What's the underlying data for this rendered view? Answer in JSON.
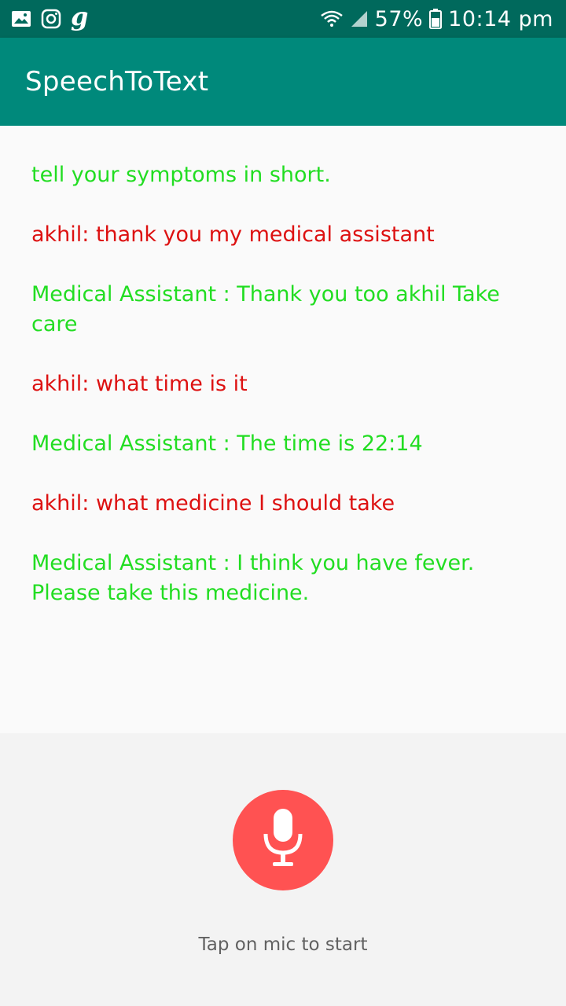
{
  "status_bar": {
    "battery_percent": "57%",
    "time": "10:14 pm",
    "left_icons": [
      "gallery-icon",
      "instagram-icon",
      "g-app-icon"
    ],
    "g_glyph": "g"
  },
  "app_bar": {
    "title": "SpeechToText"
  },
  "messages": [
    {
      "text": "tell your symptoms in short.",
      "color": "#22dd22"
    },
    {
      "text": "akhil: thank you my medical assistant",
      "color": "#dd1111"
    },
    {
      "text": "Medical Assistant : Thank you too akhil Take care",
      "color": "#22dd22"
    },
    {
      "text": "akhil: what time is it",
      "color": "#dd1111"
    },
    {
      "text": "Medical Assistant : The time is 22:14",
      "color": "#22dd22"
    },
    {
      "text": "akhil: what medicine I should take",
      "color": "#dd1111"
    },
    {
      "text": "Medical Assistant : I think you have fever. Please take this medicine.",
      "color": "#22dd22"
    }
  ],
  "mic": {
    "icon": "microphone-icon",
    "color": "#ff5252"
  },
  "hint": "Tap on mic to start",
  "colors": {
    "status_bar": "#00695c",
    "app_bar": "#00897b",
    "user_message": "#dd1111",
    "assistant_message": "#22dd22"
  }
}
